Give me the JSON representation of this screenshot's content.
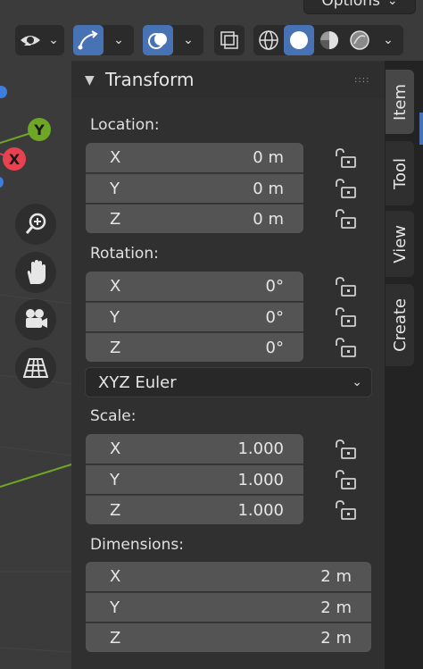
{
  "header": {
    "options_label": "Options"
  },
  "panel": {
    "title": "Transform"
  },
  "location": {
    "label": "Location:",
    "rows": [
      {
        "axis": "X",
        "value": "0 m"
      },
      {
        "axis": "Y",
        "value": "0 m"
      },
      {
        "axis": "Z",
        "value": "0 m"
      }
    ]
  },
  "rotation": {
    "label": "Rotation:",
    "rows": [
      {
        "axis": "X",
        "value": "0°"
      },
      {
        "axis": "Y",
        "value": "0°"
      },
      {
        "axis": "Z",
        "value": "0°"
      }
    ],
    "mode": "XYZ Euler"
  },
  "scale": {
    "label": "Scale:",
    "rows": [
      {
        "axis": "X",
        "value": "1.000"
      },
      {
        "axis": "Y",
        "value": "1.000"
      },
      {
        "axis": "Z",
        "value": "1.000"
      }
    ]
  },
  "dimensions": {
    "label": "Dimensions:",
    "rows": [
      {
        "axis": "X",
        "value": "2 m"
      },
      {
        "axis": "Y",
        "value": "2 m"
      },
      {
        "axis": "Z",
        "value": "2 m"
      }
    ]
  },
  "gizmo": {
    "y_label": "Y",
    "x_label": "X"
  },
  "tabs": [
    {
      "label": "Item"
    },
    {
      "label": "Tool"
    },
    {
      "label": "View"
    },
    {
      "label": "Create"
    }
  ],
  "colors": {
    "accent": "#4772b3",
    "axis_x": "#e8414f",
    "axis_y": "#6ea626",
    "axis_z": "#3d7de0"
  }
}
